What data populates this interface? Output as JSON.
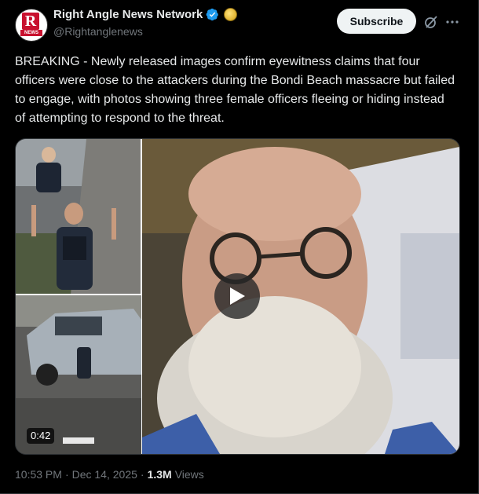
{
  "author": {
    "display_name": "Right Angle News Network",
    "handle": "@Rightanglenews",
    "avatar_letter": "R",
    "avatar_sub": "NEWS",
    "verified_color": "#1d9bf0"
  },
  "actions": {
    "subscribe_label": "Subscribe",
    "grok_icon": "grok-icon",
    "more_icon": "more-icon"
  },
  "tweet": {
    "text": "BREAKING - Newly released images confirm eyewitness claims that four officers were close to the attackers during the Bondi Beach massacre but failed to engage, with photos showing three female officers fleeing or hiding instead of attempting to respond to the threat."
  },
  "media": {
    "duration": "0:42",
    "play_icon": "play-icon"
  },
  "meta": {
    "time": "10:53 PM",
    "sep1": "·",
    "date": "Dec 14, 2025",
    "sep2": "·",
    "views_count": "1.3M",
    "views_label": "Views"
  }
}
